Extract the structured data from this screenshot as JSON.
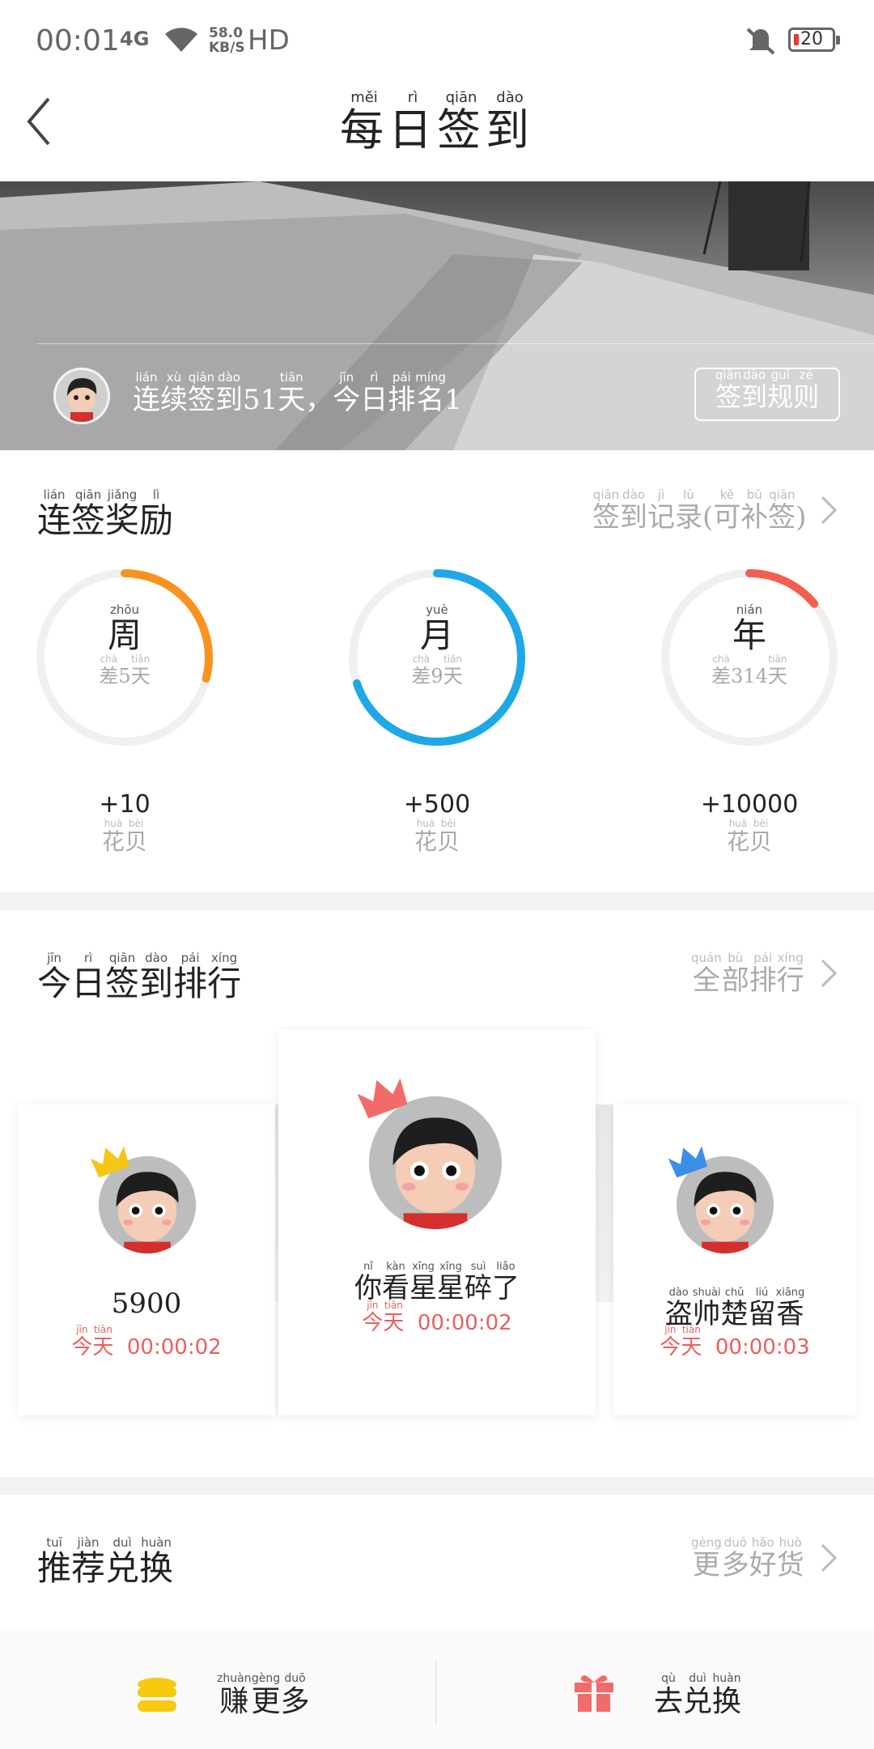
{
  "status_bar": {
    "time": "00:01",
    "network": "4G",
    "speed_value": "58.0",
    "speed_unit": "KB/S",
    "hd": "HD",
    "battery": "20"
  },
  "header": {
    "title_chars": [
      {
        "c": "每",
        "p": "měi"
      },
      {
        "c": "日",
        "p": "rì"
      },
      {
        "c": "签",
        "p": "qiān"
      },
      {
        "c": "到",
        "p": "dào"
      }
    ]
  },
  "banner": {
    "streak_chars": [
      {
        "c": "连",
        "p": "lián"
      },
      {
        "c": "续",
        "p": "xù"
      },
      {
        "c": "签",
        "p": "qiān"
      },
      {
        "c": "到",
        "p": "dào"
      },
      {
        "c": "51",
        "p": ""
      },
      {
        "c": "天",
        "p": "tiān"
      },
      {
        "c": "，",
        "p": ""
      },
      {
        "c": "今",
        "p": "jīn"
      },
      {
        "c": "日",
        "p": "rì"
      },
      {
        "c": "排",
        "p": "pái"
      },
      {
        "c": "名",
        "p": "míng"
      },
      {
        "c": "1",
        "p": ""
      }
    ],
    "rules_chars": [
      {
        "c": "签",
        "p": "qiān"
      },
      {
        "c": "到",
        "p": "dào"
      },
      {
        "c": "规",
        "p": "guī"
      },
      {
        "c": "则",
        "p": "zé"
      }
    ]
  },
  "rewards_section": {
    "title_chars": [
      {
        "c": "连",
        "p": "lián"
      },
      {
        "c": "签",
        "p": "qiān"
      },
      {
        "c": "奖",
        "p": "jiǎng"
      },
      {
        "c": "励",
        "p": "lì"
      }
    ],
    "link_chars": [
      {
        "c": "签",
        "p": "qiān"
      },
      {
        "c": "到",
        "p": "dào"
      },
      {
        "c": "记",
        "p": "jì"
      },
      {
        "c": "录",
        "p": "lù"
      },
      {
        "c": "(",
        "p": ""
      },
      {
        "c": "可",
        "p": "kě"
      },
      {
        "c": "补",
        "p": "bǔ"
      },
      {
        "c": "签",
        "p": "qiān"
      },
      {
        "c": ")",
        "p": ""
      }
    ],
    "rings": [
      {
        "label": "周",
        "label_py": "zhōu",
        "remaining": "5",
        "progress": 0.29,
        "color": "#f7931e",
        "points": "+10"
      },
      {
        "label": "月",
        "label_py": "yuè",
        "remaining": "9",
        "progress": 0.7,
        "color": "#1fa8e8",
        "points": "+500"
      },
      {
        "label": "年",
        "label_py": "nián",
        "remaining": "314",
        "progress": 0.14,
        "color": "#f25f4f",
        "points": "+10000"
      }
    ],
    "diff_chars": [
      {
        "c": "差",
        "p": "chà"
      },
      {
        "c": "天",
        "p": "tiān"
      }
    ],
    "unit_chars": [
      {
        "c": "花",
        "p": "huā"
      },
      {
        "c": "贝",
        "p": "bèi"
      }
    ]
  },
  "ranking_section": {
    "title_chars": [
      {
        "c": "今",
        "p": "jīn"
      },
      {
        "c": "日",
        "p": "rì"
      },
      {
        "c": "签",
        "p": "qiān"
      },
      {
        "c": "到",
        "p": "dào"
      },
      {
        "c": "排",
        "p": "pái"
      },
      {
        "c": "行",
        "p": "xíng"
      }
    ],
    "link_chars": [
      {
        "c": "全",
        "p": "quán"
      },
      {
        "c": "部",
        "p": "bù"
      },
      {
        "c": "排",
        "p": "pái"
      },
      {
        "c": "行",
        "p": "xíng"
      }
    ],
    "today_chars": [
      {
        "c": "今",
        "p": "jīn"
      },
      {
        "c": "天",
        "p": "tiān"
      }
    ],
    "users": [
      {
        "rank": 2,
        "name_chars": [
          {
            "c": "5900",
            "p": ""
          }
        ],
        "time": "00:00:02",
        "crown": "#f5c518"
      },
      {
        "rank": 1,
        "name_chars": [
          {
            "c": "你",
            "p": "nǐ"
          },
          {
            "c": "看",
            "p": "kàn"
          },
          {
            "c": "星",
            "p": "xīng"
          },
          {
            "c": "星",
            "p": "xīng"
          },
          {
            "c": "碎",
            "p": "suì"
          },
          {
            "c": "了",
            "p": "liǎo"
          }
        ],
        "time": "00:00:02",
        "crown": "#f26b6b"
      },
      {
        "rank": 3,
        "name_chars": [
          {
            "c": "盗",
            "p": "dào"
          },
          {
            "c": "帅",
            "p": "shuài"
          },
          {
            "c": "楚",
            "p": "chǔ"
          },
          {
            "c": "留",
            "p": "liú"
          },
          {
            "c": "香",
            "p": "xiāng"
          }
        ],
        "time": "00:00:03",
        "crown": "#3b8fe8"
      }
    ]
  },
  "recommend_section": {
    "title_chars": [
      {
        "c": "推",
        "p": "tuī"
      },
      {
        "c": "荐",
        "p": "jiàn"
      },
      {
        "c": "兑",
        "p": "duì"
      },
      {
        "c": "换",
        "p": "huàn"
      }
    ],
    "link_chars": [
      {
        "c": "更",
        "p": "gèng"
      },
      {
        "c": "多",
        "p": "duō"
      },
      {
        "c": "好",
        "p": "hǎo"
      },
      {
        "c": "货",
        "p": "huò"
      }
    ]
  },
  "bottom_bar": {
    "earn_chars": [
      {
        "c": "赚",
        "p": "zhuàn"
      },
      {
        "c": "更",
        "p": "gèng"
      },
      {
        "c": "多",
        "p": "duō"
      }
    ],
    "exchange_chars": [
      {
        "c": "去",
        "p": "qù"
      },
      {
        "c": "兑",
        "p": "duì"
      },
      {
        "c": "换",
        "p": "huàn"
      }
    ],
    "earn_icon_color": "#f7c90f",
    "exchange_icon_color": "#f26b6b"
  }
}
